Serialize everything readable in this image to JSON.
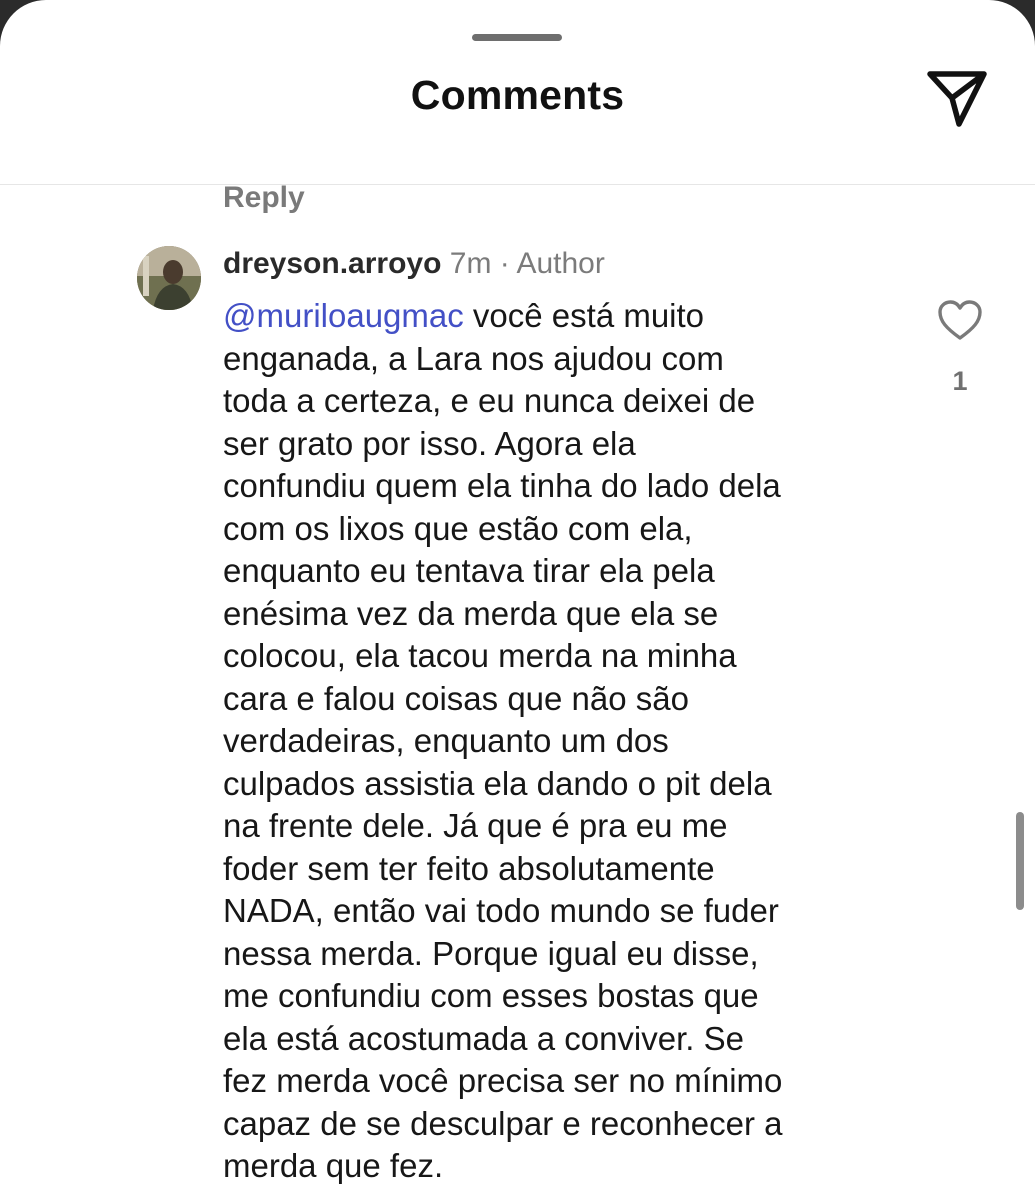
{
  "header": {
    "title": "Comments",
    "share_icon": "send-icon"
  },
  "previous_reply_label": "Reply",
  "comment": {
    "username": "dreyson.arroyo",
    "time": "7m",
    "separator": " · ",
    "badge": "Author",
    "mention": "@muriloaugmac",
    "lines": [
      " você está muito",
      "enganada, a Lara nos ajudou com",
      "toda a certeza, e eu nunca deixei de",
      "ser grato por isso. Agora ela",
      "confundiu quem ela tinha do lado dela",
      "com os lixos que estão com ela,",
      "enquanto eu tentava tirar ela pela",
      "enésima vez da merda que ela se",
      "colocou, ela tacou merda na minha",
      "cara e falou coisas que não são",
      "verdadeiras, enquanto um dos",
      "culpados assistia ela dando o pit dela",
      "na frente dele. Já que é pra eu me",
      "foder sem ter feito absolutamente",
      "NADA, então vai todo mundo se fuder",
      "nessa merda. Porque igual eu disse,",
      "me confundiu com esses bostas que",
      "ela está acostumada a conviver. Se",
      "fez merda você precisa ser no mínimo",
      "capaz de se desculpar e reconhecer a",
      "merda que fez."
    ],
    "like_icon": "heart-icon",
    "like_count": "1"
  },
  "colors": {
    "mention": "#4350c6",
    "text": "#171717",
    "muted": "#7b7b7b"
  }
}
